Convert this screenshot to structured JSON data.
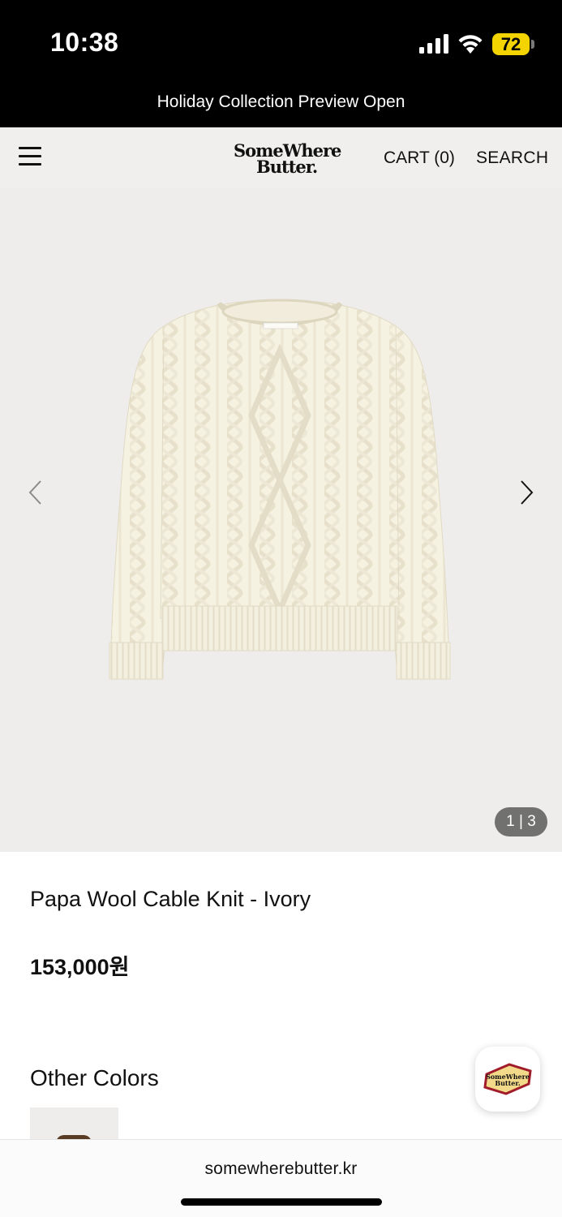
{
  "status_bar": {
    "time": "10:38",
    "battery": "72",
    "icons": [
      "signal-icon",
      "wifi-icon",
      "battery-icon"
    ]
  },
  "announcement": "Holiday Collection Preview Open",
  "header": {
    "logo_line1": "SomeWhere",
    "logo_line2": "Butter.",
    "cart_label": "CART (0)",
    "search_label": "SEARCH"
  },
  "gallery": {
    "pager": "1 | 3",
    "sweater_tag": "SOMEWHERE BUTTER"
  },
  "product": {
    "title": "Papa Wool Cable Knit - Ivory",
    "price": "153,000원"
  },
  "other_colors": {
    "heading": "Other Colors"
  },
  "chat_logo": {
    "line1": "SomeWhere",
    "line2": "Butter."
  },
  "browser": {
    "url": "somewherebutter.kr"
  },
  "colors": {
    "background": "#ffffff",
    "header_bg": "#f0efee",
    "gallery_bg": "#efedeb",
    "battery": "#f3d400",
    "sweater": "#f6f2e2",
    "swatch_brown": "#5a3b24"
  }
}
